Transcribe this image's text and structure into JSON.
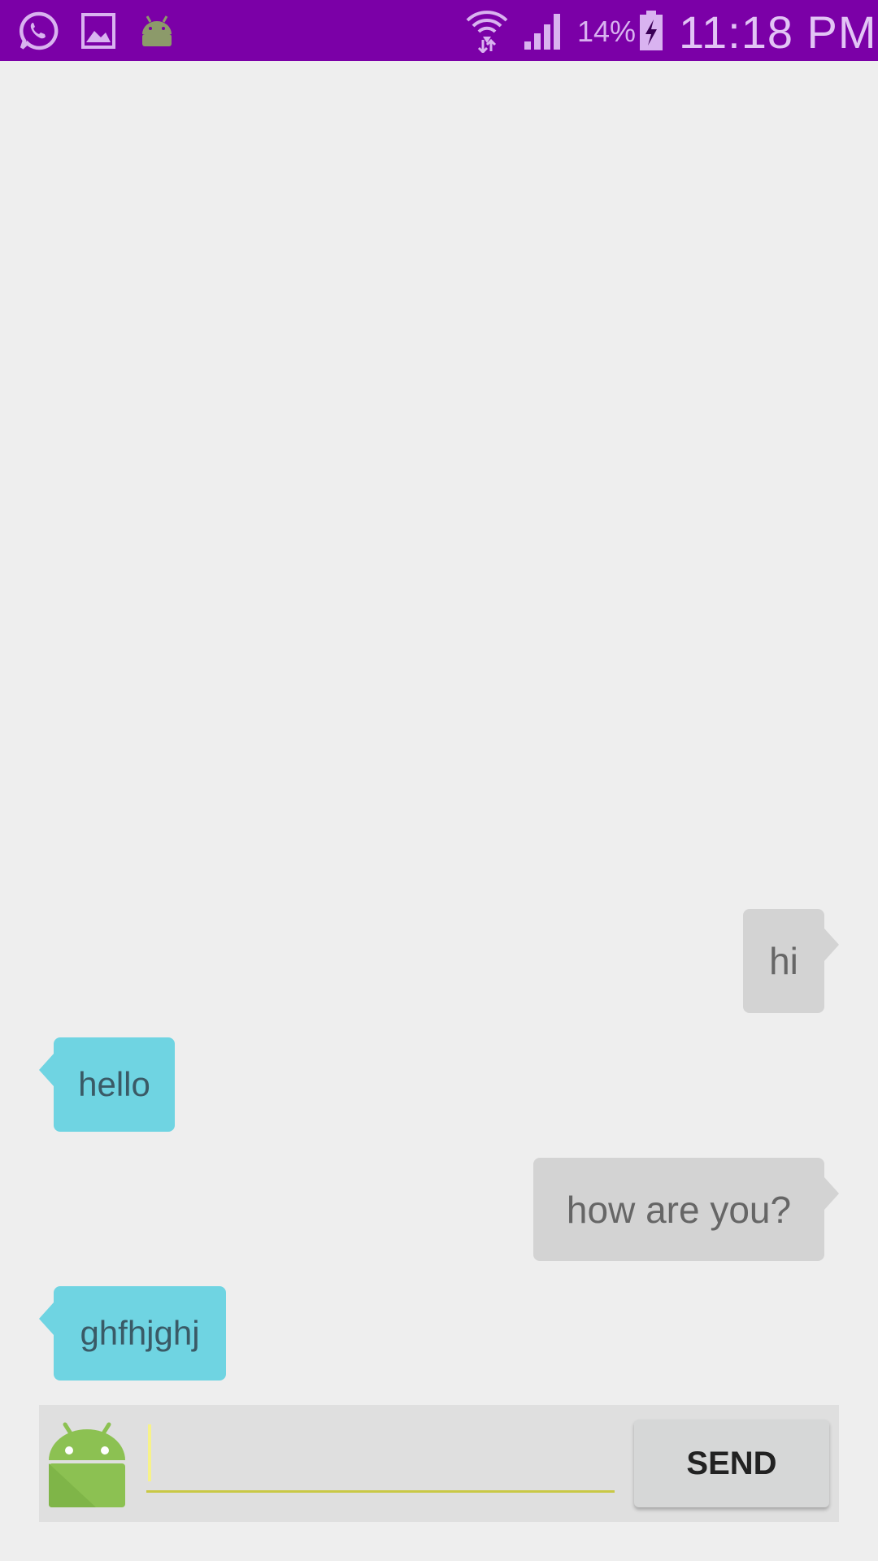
{
  "status_bar": {
    "background": "#7b00a7",
    "notification_icons": [
      "whatsapp-icon",
      "image-icon",
      "android-icon"
    ],
    "system_icons": [
      "wifi-icon",
      "signal-icon",
      "battery-charging-icon"
    ],
    "battery_text": "14%",
    "time": "11:18 PM"
  },
  "chat": {
    "messages": [
      {
        "direction": "outgoing",
        "text": "hi"
      },
      {
        "direction": "incoming",
        "text": "hello"
      },
      {
        "direction": "outgoing",
        "text": "how are you?"
      },
      {
        "direction": "incoming",
        "text": "ghfhjghj"
      }
    ],
    "colors": {
      "outgoing": "#d3d3d3",
      "incoming": "#6fd4e2",
      "background": "#eeeeee"
    }
  },
  "composer": {
    "avatar_icon": "android-icon",
    "input_value": "",
    "input_placeholder": "",
    "send_label": "SEND"
  }
}
